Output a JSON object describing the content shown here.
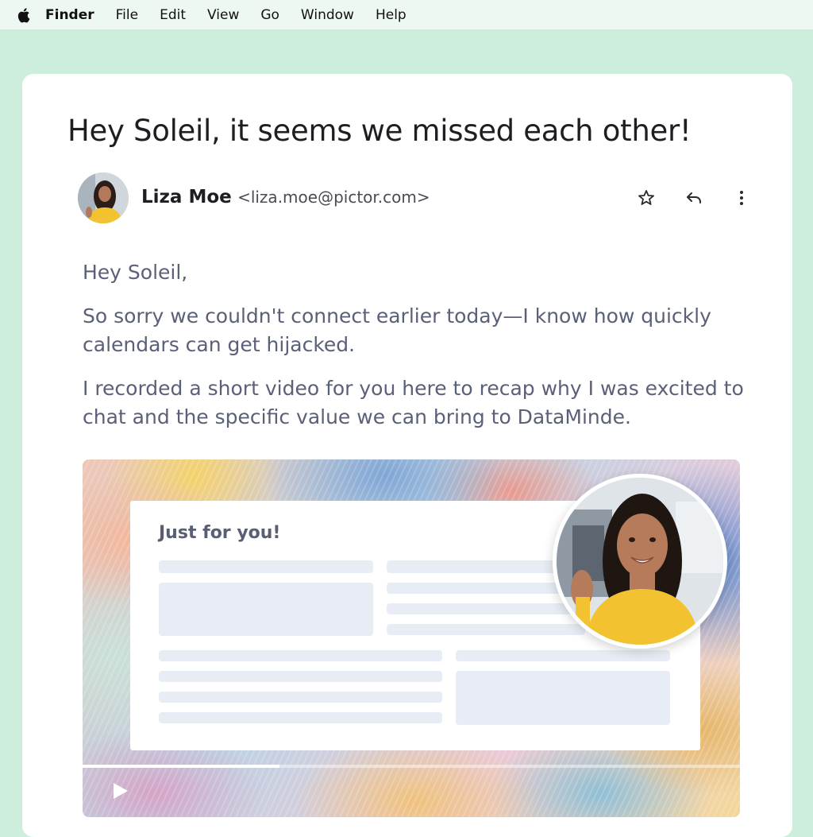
{
  "menubar": {
    "app_name": "Finder",
    "items": [
      "File",
      "Edit",
      "View",
      "Go",
      "Window",
      "Help"
    ]
  },
  "email": {
    "subject": "Hey Soleil, it seems we missed each other!",
    "sender_name": "Liza Moe",
    "sender_email": "<liza.moe@pictor.com>",
    "paragraphs": [
      "Hey Soleil,",
      "So sorry we couldn't connect earlier today—I know how quickly calendars can get hijacked.",
      "I recorded a short video for you here to recap why I was excited to chat and the specific value we can bring to DataMinde."
    ],
    "actions": [
      "star-icon",
      "reply-icon",
      "more-vertical-icon"
    ]
  },
  "video": {
    "card_title": "Just for you!",
    "progress": 0.3,
    "controls": [
      "play-icon"
    ]
  },
  "colors": {
    "background": "#cdeedd",
    "menubar": "#eef8f2",
    "body_text": "#5b6079",
    "placeholder": "#e8edf5",
    "sweater": "#f2c230"
  }
}
